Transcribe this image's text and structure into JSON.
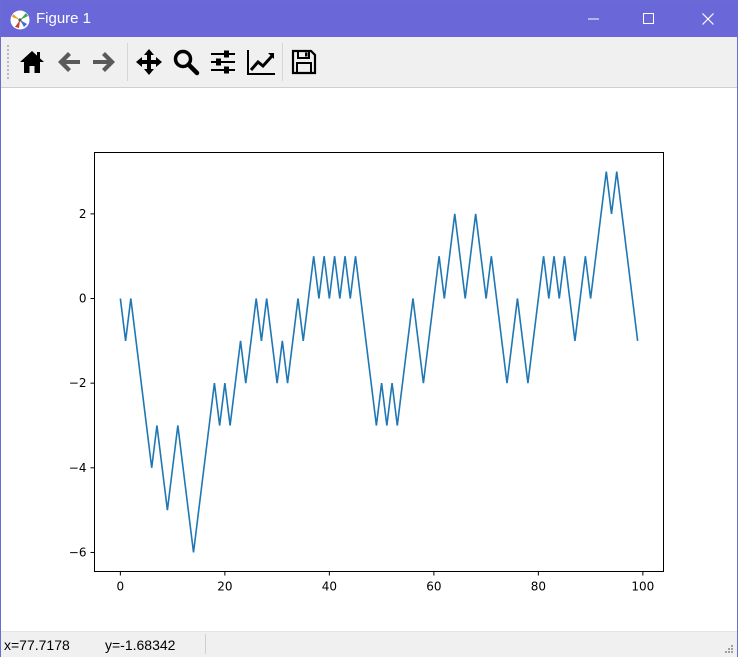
{
  "window": {
    "title": "Figure 1",
    "controls": [
      "minimize",
      "maximize",
      "close"
    ]
  },
  "toolbar": {
    "buttons": [
      {
        "icon": "home-icon",
        "tooltip": "Home"
      },
      {
        "icon": "back-arrow-icon",
        "tooltip": "Back"
      },
      {
        "icon": "forward-arrow-icon",
        "tooltip": "Forward"
      },
      {
        "icon": "pan-move-icon",
        "tooltip": "Pan"
      },
      {
        "icon": "zoom-magnifier-icon",
        "tooltip": "Zoom"
      },
      {
        "icon": "configure-subplots-icon",
        "tooltip": "Subplots"
      },
      {
        "icon": "edit-axis-icon",
        "tooltip": "Customize"
      },
      {
        "icon": "save-floppy-icon",
        "tooltip": "Save"
      }
    ]
  },
  "status": {
    "x_readout": "x=77.7178",
    "y_readout": "y=-1.68342"
  },
  "colors": {
    "titlebar": "#6a67d8",
    "line": "#1f77b4"
  },
  "chart_data": {
    "type": "line",
    "title": "",
    "xlabel": "",
    "ylabel": "",
    "xlim": [
      -4.95,
      103.95
    ],
    "ylim": [
      -6.45,
      3.45
    ],
    "xticks": [
      0,
      20,
      40,
      60,
      80,
      100
    ],
    "yticks": [
      2,
      0,
      -2,
      -4,
      -6
    ],
    "xtick_labels": [
      "0",
      "20",
      "40",
      "60",
      "80",
      "100"
    ],
    "ytick_labels": [
      "2",
      "0",
      "−2",
      "−4",
      "−6"
    ],
    "grid": false,
    "legend": "none",
    "series": [
      {
        "x": [
          0,
          1,
          2,
          3,
          4,
          5,
          6,
          7,
          8,
          9,
          10,
          11,
          12,
          13,
          14,
          15,
          16,
          17,
          18,
          19,
          20,
          21,
          22,
          23,
          24,
          25,
          26,
          27,
          28,
          29,
          30,
          31,
          32,
          33,
          34,
          35,
          36,
          37,
          38,
          39,
          40,
          41,
          42,
          43,
          44,
          45,
          46,
          47,
          48,
          49,
          50,
          51,
          52,
          53,
          54,
          55,
          56,
          57,
          58,
          59,
          60,
          61,
          62,
          63,
          64,
          65,
          66,
          67,
          68,
          69,
          70,
          71,
          72,
          73,
          74,
          75,
          76,
          77,
          78,
          79,
          80,
          81,
          82,
          83,
          84,
          85,
          86,
          87,
          88,
          89,
          90,
          91,
          92,
          93,
          94,
          95,
          96,
          97,
          98,
          99
        ],
        "y": [
          0,
          -1,
          0,
          -1,
          -2,
          -3,
          -4,
          -3,
          -4,
          -5,
          -4,
          -3,
          -4,
          -5,
          -6,
          -5,
          -4,
          -3,
          -2,
          -3,
          -2,
          -3,
          -2,
          -1,
          -2,
          -1,
          0,
          -1,
          0,
          -1,
          -2,
          -1,
          -2,
          -1,
          0,
          -1,
          0,
          1,
          0,
          1,
          0,
          1,
          0,
          1,
          0,
          1,
          0,
          -1,
          -2,
          -3,
          -2,
          -3,
          -2,
          -3,
          -2,
          -1,
          0,
          -1,
          -2,
          -1,
          0,
          1,
          0,
          1,
          2,
          1,
          0,
          1,
          2,
          1,
          0,
          1,
          0,
          -1,
          -2,
          -1,
          0,
          -1,
          -2,
          -1,
          0,
          1,
          0,
          1,
          0,
          1,
          0,
          -1,
          0,
          1,
          0,
          1,
          2,
          3,
          2,
          3,
          2,
          1,
          0,
          -1
        ]
      }
    ]
  }
}
